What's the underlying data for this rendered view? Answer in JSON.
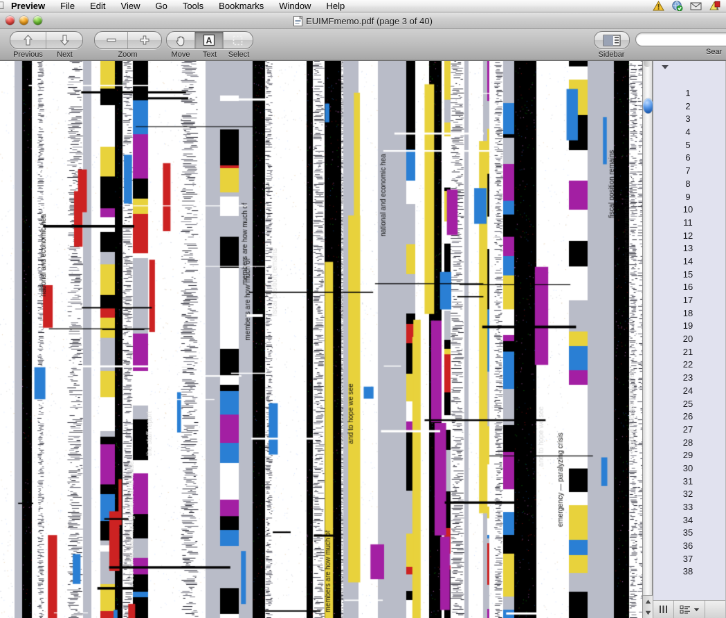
{
  "menubar": {
    "apple_logo": "apple-logo",
    "items": [
      {
        "label": "Preview",
        "bold": true
      },
      {
        "label": "File",
        "bold": false
      },
      {
        "label": "Edit",
        "bold": false
      },
      {
        "label": "View",
        "bold": false
      },
      {
        "label": "Go",
        "bold": false
      },
      {
        "label": "Tools",
        "bold": false
      },
      {
        "label": "Bookmarks",
        "bold": false
      },
      {
        "label": "Window",
        "bold": false
      },
      {
        "label": "Help",
        "bold": false
      }
    ],
    "status_icons": [
      {
        "name": "warning-triangle-icon"
      },
      {
        "name": "green-check-globe-icon"
      },
      {
        "name": "envelope-mail-icon"
      },
      {
        "name": "red-flag-icon"
      }
    ]
  },
  "window": {
    "title": "EUIMFmemo.pdf (page 3 of 40)",
    "doc_icon": "pdf-document-icon",
    "lights": [
      {
        "name": "close-button"
      },
      {
        "name": "minimize-button"
      },
      {
        "name": "zoom-button"
      }
    ]
  },
  "toolbar": {
    "nav": {
      "label_previous": "Previous",
      "label_next": "Next",
      "icon_previous": "arrow-up-icon",
      "icon_next": "arrow-down-icon"
    },
    "zoom": {
      "label": "Zoom",
      "icon_out": "minus-icon",
      "icon_in": "plus-icon"
    },
    "tools": {
      "label_move": "Move",
      "label_text": "Text",
      "label_select": "Select",
      "icon_move": "hand-icon",
      "icon_text": "text-a-icon",
      "icon_select": "marquee-select-icon",
      "selected": "Text"
    },
    "sidebar": {
      "label": "Sidebar",
      "icon": "sidebar-panel-icon"
    },
    "search": {
      "label": "Sear",
      "placeholder": "",
      "value": "",
      "icon": "search-magnifier-icon"
    }
  },
  "sidebar": {
    "disclosure_icon": "disclosure-triangle-icon",
    "page_numbers": [
      1,
      2,
      3,
      4,
      5,
      6,
      7,
      8,
      9,
      10,
      11,
      12,
      13,
      14,
      15,
      16,
      17,
      18,
      19,
      20,
      21,
      22,
      23,
      24,
      25,
      26,
      27,
      28,
      29,
      30,
      31,
      32,
      33,
      34,
      35,
      36,
      37,
      38
    ],
    "bottom_bar": {
      "columns_icon": "column-view-icon",
      "list_icon": "list-view-icon",
      "list_dropdown_icon": "chevron-down-icon"
    }
  },
  "document": {
    "state": "corrupted-render",
    "description": "Glitched PDF page render: vertical black, white and gray stripe bands with RGB speckle noise and rotated text fragments",
    "palette": {
      "black": "#000000",
      "white": "#ffffff",
      "yellow": "#e8d23c",
      "blue": "#2a7fd4",
      "magenta": "#a31fa3",
      "red": "#cc2222",
      "gray": "#b9bcc8"
    },
    "scrollbar": {
      "thumb_name": "document-scroll-thumb",
      "up_icon": "scroll-up-arrow-icon",
      "down_icon": "scroll-down-arrow-icon"
    }
  }
}
